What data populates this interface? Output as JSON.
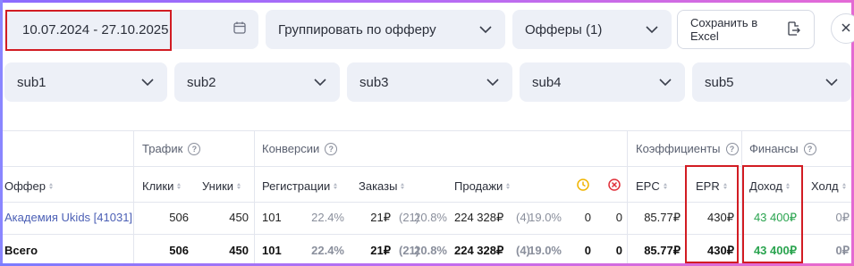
{
  "date_range": "10.07.2024 - 27.10.2025",
  "filters": {
    "group_by": "Группировать по офферу",
    "offers": "Офферы (1)",
    "excel_button": "Сохранить в Excel"
  },
  "subs": [
    "sub1",
    "sub2",
    "sub3",
    "sub4",
    "sub5"
  ],
  "groups": {
    "traffic": "Трафик",
    "conversions": "Конверсии",
    "coefficients": "Коэффициенты",
    "finance": "Финансы"
  },
  "columns": {
    "offer": "Оффер",
    "clicks": "Клики",
    "uniques": "Уники",
    "registrations": "Регистрации",
    "orders": "Заказы",
    "sales": "Продажи",
    "epc": "EPC",
    "epr": "EPR",
    "income": "Доход",
    "hold": "Холд"
  },
  "rows": [
    {
      "offer": "Академия Ukids [41031]",
      "clicks": "506",
      "uniques": "450",
      "reg": "101",
      "reg_pct": "22.4%",
      "orders": "21₽",
      "orders_cnt": "(21)",
      "orders_pct": "20.8%",
      "sales": "224 328₽",
      "sales_cnt": "(4)",
      "sales_pct": "19.0%",
      "pending": "0",
      "rejected": "0",
      "epc": "85.77₽",
      "epr": "430₽",
      "income": "43 400₽",
      "hold": "0₽"
    }
  ],
  "total": {
    "label": "Всего",
    "clicks": "506",
    "uniques": "450",
    "reg": "101",
    "reg_pct": "22.4%",
    "orders": "21₽",
    "orders_cnt": "(21)",
    "orders_pct": "20.8%",
    "sales": "224 328₽",
    "sales_cnt": "(4)",
    "sales_pct": "19.0%",
    "pending": "0",
    "rejected": "0",
    "epc": "85.77₽",
    "epr": "430₽",
    "income": "43 400₽",
    "hold": "0₽"
  },
  "colors": {
    "highlight": "#d21c23",
    "income": "#2aa44f",
    "link": "#4b5fb5",
    "pending_icon": "#f0b400",
    "rejected_icon": "#e0303a"
  }
}
